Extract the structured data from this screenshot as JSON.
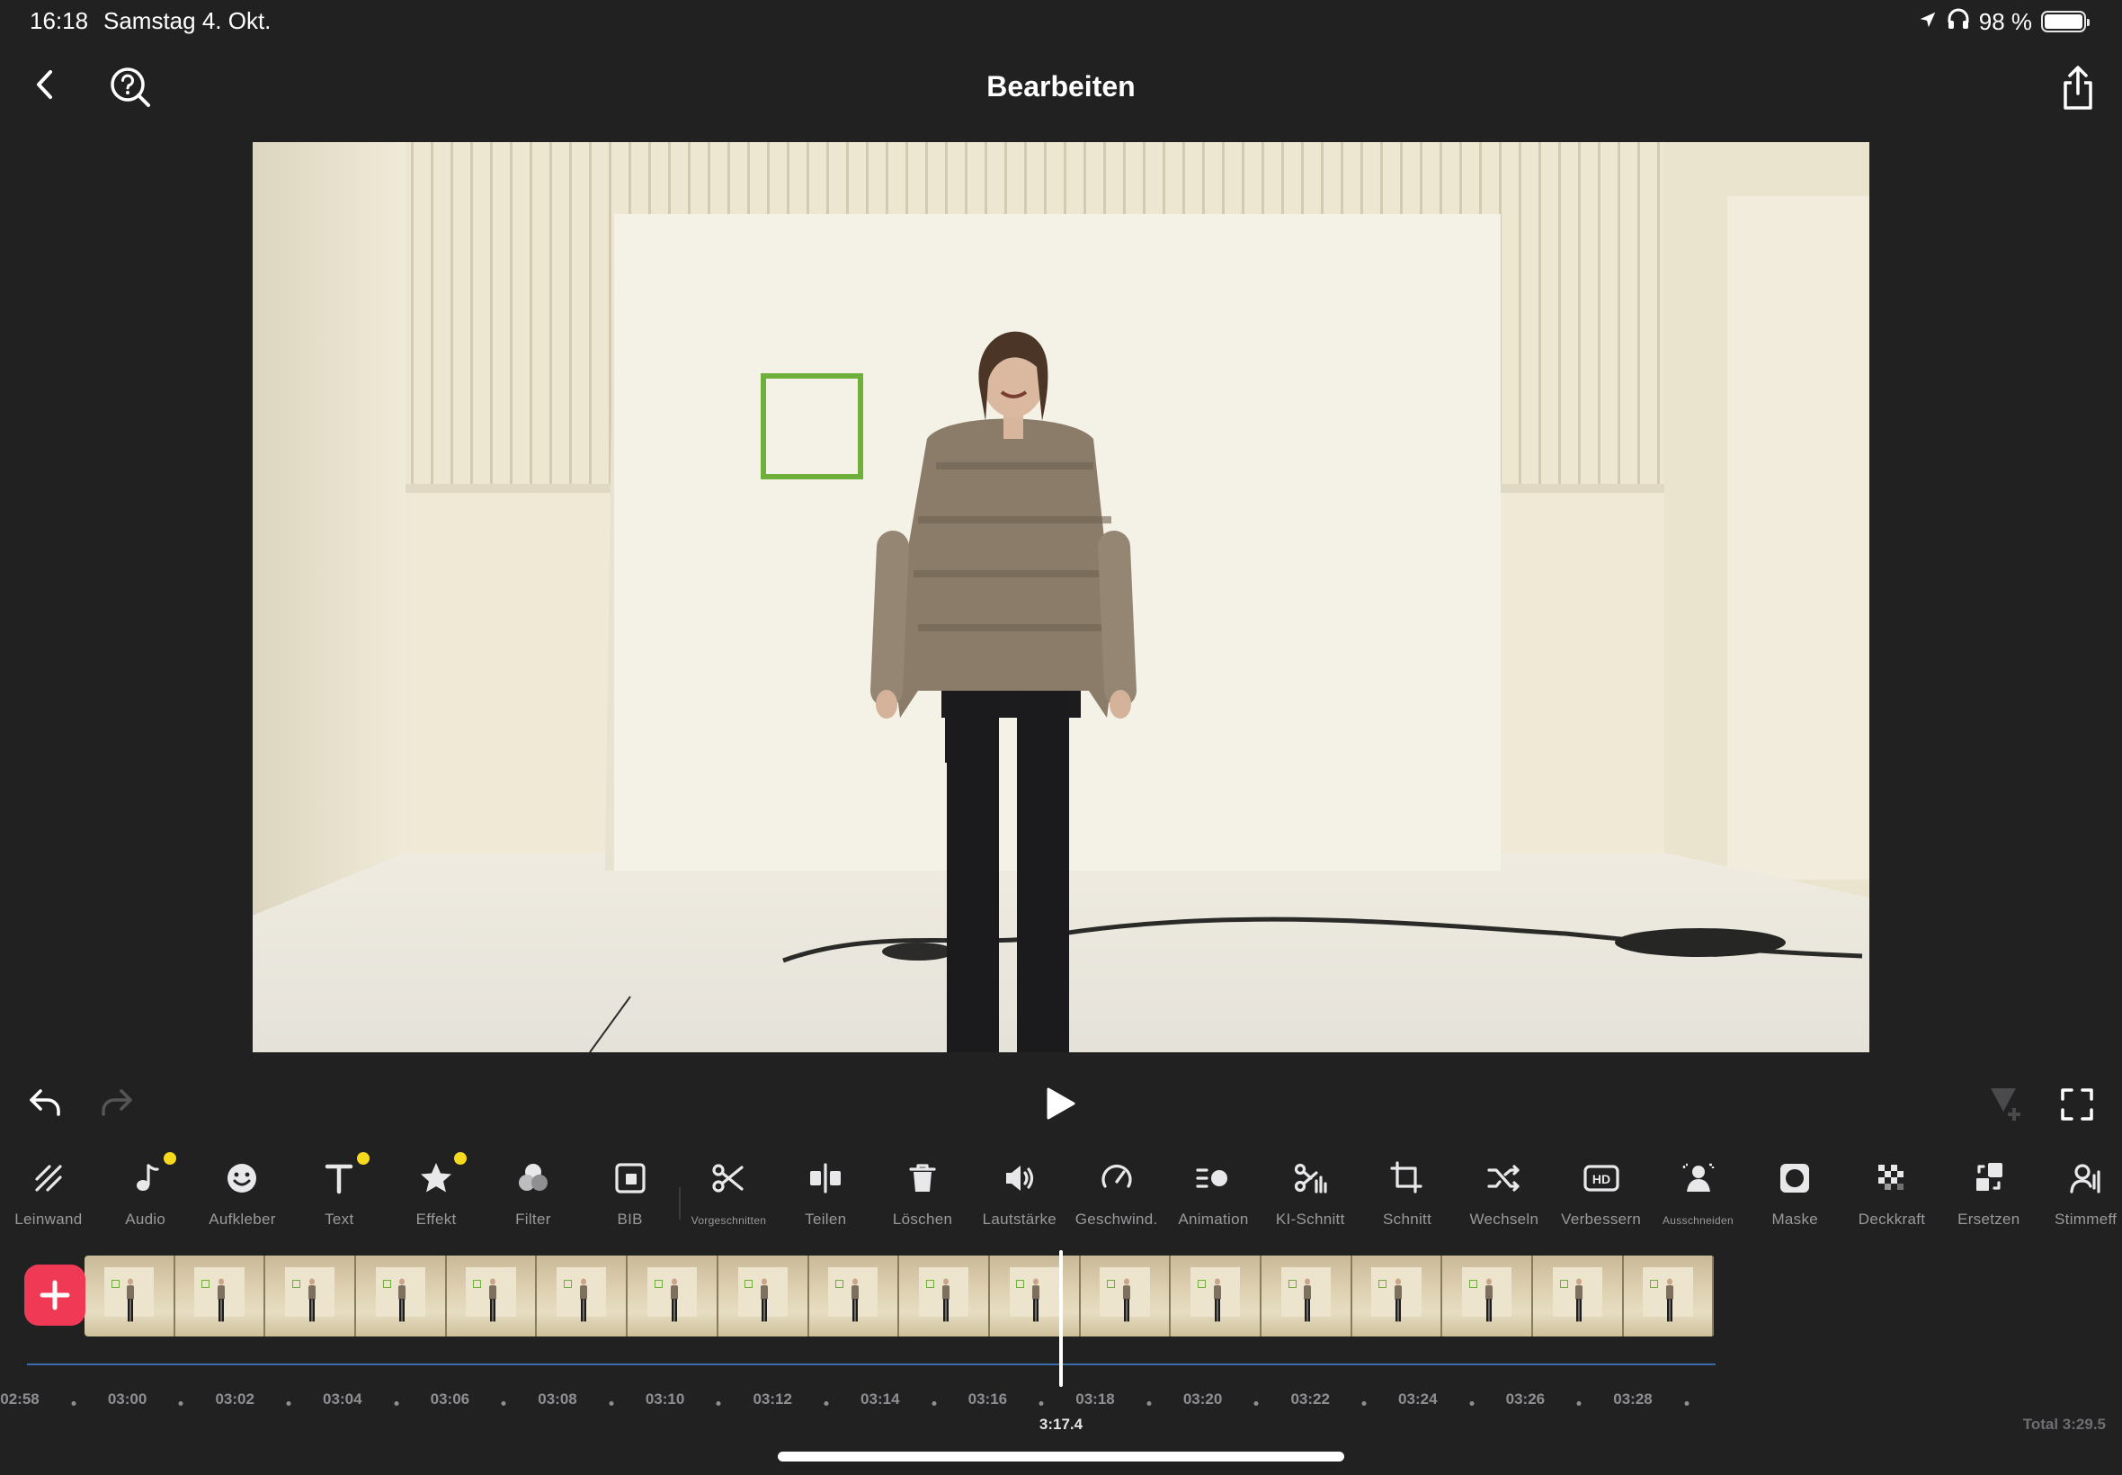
{
  "status_bar": {
    "time": "16:18",
    "date": "Samstag 4. Okt.",
    "battery": "98 %"
  },
  "nav": {
    "title": "Bearbeiten"
  },
  "toolbar": [
    {
      "label": "Leinwand",
      "icon": "canvas-icon",
      "dot": false
    },
    {
      "label": "Audio",
      "icon": "music-note-icon",
      "dot": true
    },
    {
      "label": "Aufkleber",
      "icon": "sticker-icon",
      "dot": false
    },
    {
      "label": "Text",
      "icon": "text-icon",
      "dot": true
    },
    {
      "label": "Effekt",
      "icon": "star-icon",
      "dot": true
    },
    {
      "label": "Filter",
      "icon": "filter-icon",
      "dot": false
    },
    {
      "label": "BIB",
      "icon": "picture-in-picture-icon",
      "dot": false
    },
    {
      "label": "Vorgeschnitten",
      "icon": "scissors-icon",
      "dot": false
    },
    {
      "label": "Teilen",
      "icon": "split-icon",
      "dot": false
    },
    {
      "label": "Löschen",
      "icon": "trash-icon",
      "dot": false
    },
    {
      "label": "Lautstärke",
      "icon": "volume-icon",
      "dot": false
    },
    {
      "label": "Geschwind.",
      "icon": "speed-gauge-icon",
      "dot": false
    },
    {
      "label": "Animation",
      "icon": "animation-icon",
      "dot": false
    },
    {
      "label": "KI-Schnitt",
      "icon": "ai-cut-icon",
      "dot": false
    },
    {
      "label": "Schnitt",
      "icon": "crop-icon",
      "dot": false
    },
    {
      "label": "Wechseln",
      "icon": "shuffle-icon",
      "dot": false
    },
    {
      "label": "Verbessern",
      "icon": "hd-icon",
      "dot": false
    },
    {
      "label": "Ausschneiden",
      "icon": "cutout-person-icon",
      "dot": false
    },
    {
      "label": "Maske",
      "icon": "mask-icon",
      "dot": false
    },
    {
      "label": "Deckkraft",
      "icon": "opacity-icon",
      "dot": false
    },
    {
      "label": "Ersetzen",
      "icon": "replace-icon",
      "dot": false
    },
    {
      "label": "Stimmeff",
      "icon": "voice-effect-icon",
      "dot": false
    }
  ],
  "timeline": {
    "ticks": [
      "02:58",
      "03:00",
      "03:02",
      "03:04",
      "03:06",
      "03:08",
      "03:10",
      "03:12",
      "03:14",
      "03:16",
      "03:18",
      "03:20",
      "03:22",
      "03:24",
      "03:26",
      "03:28"
    ],
    "current_time": "3:17.4",
    "total": "Total 3:29.5"
  }
}
